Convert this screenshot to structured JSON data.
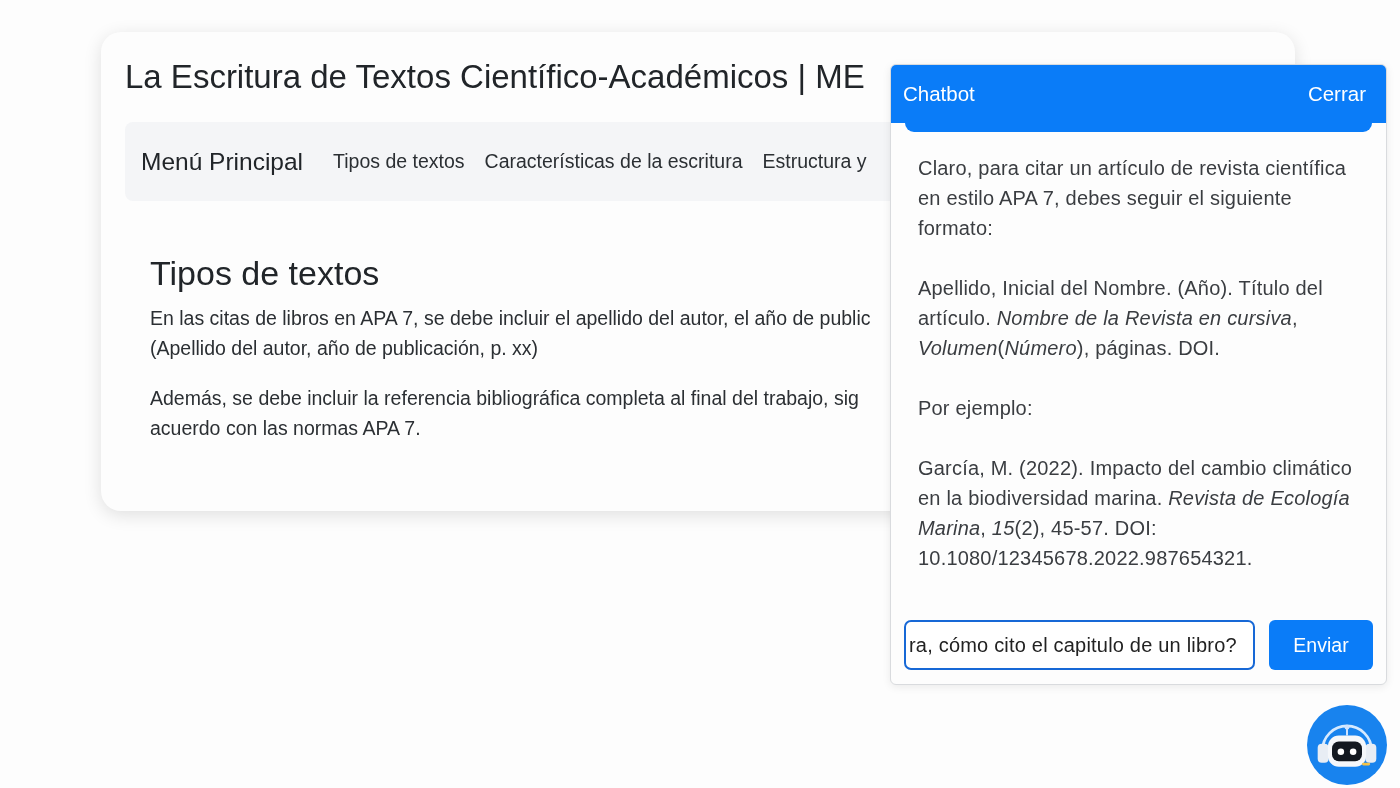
{
  "page": {
    "title": "La Escritura de Textos Científico-Académicos | ME"
  },
  "navbar": {
    "brand": "Menú Principal",
    "links": [
      "Tipos de textos",
      "Características de la escritura",
      "Estructura y"
    ]
  },
  "section": {
    "heading": "Tipos de textos",
    "paragraphs": [
      {
        "lines": [
          "En las citas de libros en APA 7, se debe incluir el apellido del autor, el año de public",
          "(Apellido del autor, año de publicación, p. xx)"
        ]
      },
      {
        "lines": [
          "Además, se debe incluir la referencia bibliográfica completa al final del trabajo, sig",
          "acuerdo con las normas APA 7."
        ]
      }
    ]
  },
  "chatbot": {
    "title": "Chatbot",
    "close": "Cerrar",
    "messages": [
      {
        "kind": "bot",
        "text": "Claro, para citar un artículo de revista científica en estilo APA 7, debes seguir el siguiente formato:\n\nApellido, Inicial del Nombre. (Año). Título del artículo. *Nombre de la Revista en cursiva*, *Volumen*(*Número*), páginas. DOI.\n\nPor ejemplo:\n\nGarcía, M. (2022). Impacto del cambio climático en la biodiversidad marina. *Revista de Ecología Marina*, *15*(2), 45-57. DOI: 10.1080/12345678.2022.987654321."
      }
    ],
    "input": {
      "value": "ra, cómo cito el capitulo de un libro?"
    },
    "send": "Enviar"
  }
}
